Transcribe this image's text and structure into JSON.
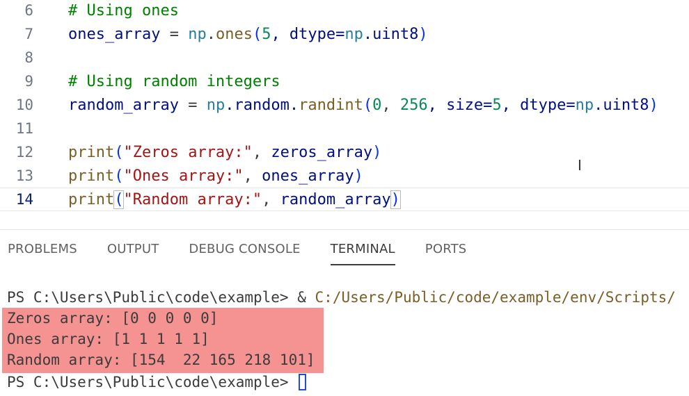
{
  "editor": {
    "lines": [
      {
        "num": "6",
        "comment": "# Using ones"
      },
      {
        "num": "7",
        "var": "ones_array",
        "eq": " = ",
        "mod": "np",
        "dot": ".",
        "fn": "ones",
        "open": "(",
        "arg1": "5",
        "mid": ", dtype=",
        "mod2": "np",
        "attr": ".uint8",
        "close": ")"
      },
      {
        "num": "8"
      },
      {
        "num": "9",
        "comment": "# Using random integers"
      },
      {
        "num": "10",
        "var": "random_array",
        "eq": " = ",
        "mod": "np",
        "dot": ".random.",
        "fn": "randint",
        "open": "(",
        "arg1": "0",
        "sep1": ", ",
        "arg2": "256",
        "mid": ", size=",
        "arg3": "5",
        "mid2": ", dtype=",
        "mod2": "np",
        "attr": ".uint8",
        "close": ")"
      },
      {
        "num": "11"
      },
      {
        "num": "12",
        "fn": "print",
        "open": "(",
        "str": "\"Zeros array:\"",
        "sep": ", ",
        "var": "zeros_array",
        "close": ")"
      },
      {
        "num": "13",
        "fn": "print",
        "open": "(",
        "str": "\"Ones array:\"",
        "sep": ", ",
        "var": "ones_array",
        "close": ")"
      },
      {
        "num": "14",
        "fn": "print",
        "open": "(",
        "str": "\"Random array:\"",
        "sep": ", ",
        "var": "random_array",
        "close": ")"
      }
    ]
  },
  "panel": {
    "tabs": [
      {
        "label": "PROBLEMS"
      },
      {
        "label": "OUTPUT"
      },
      {
        "label": "DEBUG CONSOLE"
      },
      {
        "label": "TERMINAL",
        "active": true
      },
      {
        "label": "PORTS"
      }
    ]
  },
  "terminal": {
    "prompt": "PS C:\\Users\\Public\\code\\example> ",
    "cmd_amp": "& ",
    "cmd_path": "C:/Users/Public/code/example/env/Scripts/",
    "output": [
      "Zeros array: [0 0 0 0 0]",
      "Ones array: [1 1 1 1 1]",
      "Random array: [154  22 165 218 101]"
    ],
    "prompt2": "PS C:\\Users\\Public\\code\\example> "
  },
  "colors": {
    "highlight": "#f48c8c",
    "active_tab_underline": "#3b3b3b",
    "cursor": "#1f4dd6"
  }
}
